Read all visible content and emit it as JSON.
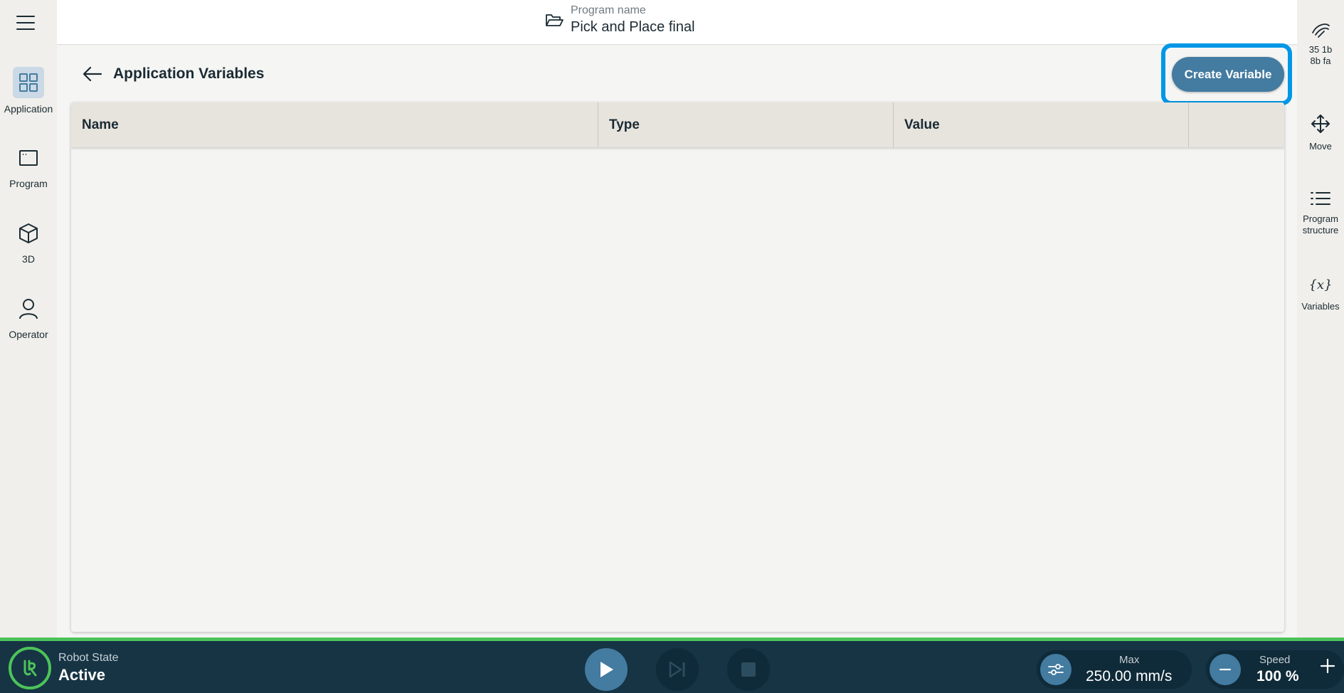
{
  "header": {
    "program_sub": "Program name",
    "program_name": "Pick and Place final"
  },
  "left_nav": {
    "items": [
      {
        "label": "Application",
        "icon": "grid-icon",
        "active": true
      },
      {
        "label": "Program",
        "icon": "program-window-icon"
      },
      {
        "label": "3D",
        "icon": "cube-icon"
      },
      {
        "label": "Operator",
        "icon": "person-icon"
      }
    ]
  },
  "main": {
    "title": "Application Variables",
    "create_button": "Create Variable",
    "table": {
      "columns": [
        "Name",
        "Type",
        "Value",
        ""
      ],
      "rows": []
    }
  },
  "right_nav": {
    "items": [
      {
        "label": "35 1b\n8b fa",
        "icon": "tcp-icon"
      },
      {
        "label": "Move",
        "icon": "move-arrows-icon"
      },
      {
        "label": "Program\nstructure",
        "icon": "list-icon"
      },
      {
        "label": "Variables",
        "icon": "variable-x-icon"
      }
    ]
  },
  "footer": {
    "robot_state_label": "Robot State",
    "robot_state_value": "Active",
    "max_label": "Max",
    "max_value": "250.00 mm/s",
    "speed_label": "Speed",
    "speed_value": "100 %"
  },
  "colors": {
    "accent": "#447ba0",
    "highlight": "#0097e6",
    "footer_bg": "#163444",
    "status_green": "#4cc35a"
  }
}
